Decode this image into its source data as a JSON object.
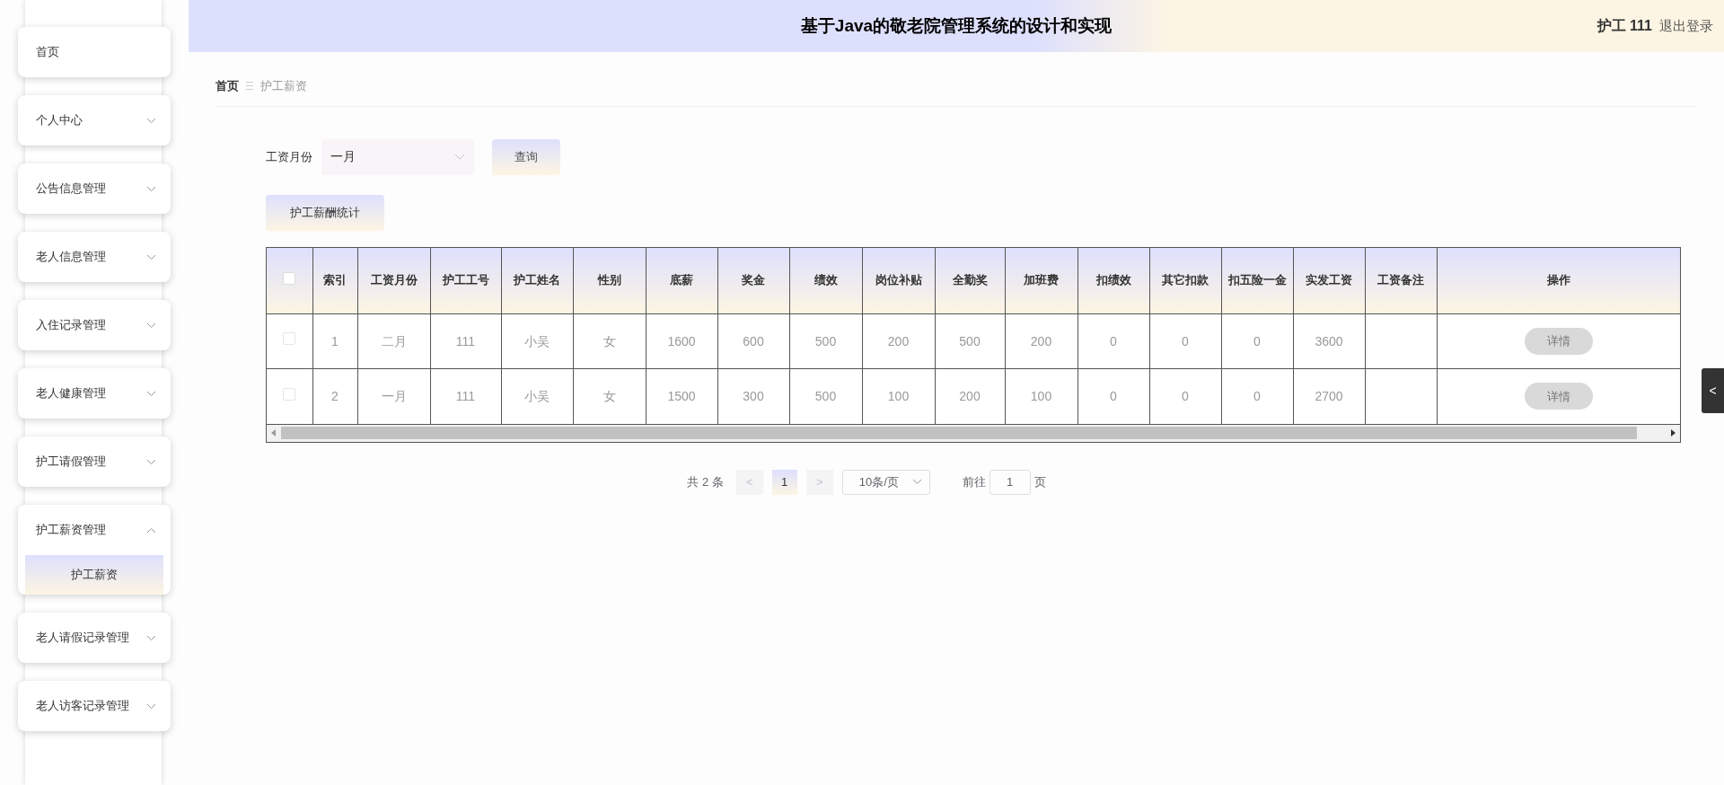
{
  "sidebar": {
    "items": [
      {
        "label": "首页",
        "kind": "link"
      },
      {
        "label": "个人中心",
        "kind": "menu",
        "expanded": false
      },
      {
        "label": "公告信息管理",
        "kind": "menu",
        "expanded": false
      },
      {
        "label": "老人信息管理",
        "kind": "menu",
        "expanded": false
      },
      {
        "label": "入住记录管理",
        "kind": "menu",
        "expanded": false
      },
      {
        "label": "老人健康管理",
        "kind": "menu",
        "expanded": false
      },
      {
        "label": "护工请假管理",
        "kind": "menu",
        "expanded": false
      },
      {
        "label": "护工薪资管理",
        "kind": "menu",
        "expanded": true,
        "children": [
          {
            "label": "护工薪资",
            "selected": true
          }
        ]
      },
      {
        "label": "老人请假记录管理",
        "kind": "menu",
        "expanded": false
      },
      {
        "label": "老人访客记录管理",
        "kind": "menu",
        "expanded": false
      }
    ]
  },
  "header": {
    "title": "基于Java的敬老院管理系统的设计和实现",
    "user": "护工 111",
    "logout": "退出登录"
  },
  "breadcrumb": [
    "首页",
    "护工薪资"
  ],
  "filter": {
    "label": "工资月份",
    "select_value": "一月",
    "search_button": "查询"
  },
  "stats_button": "护工薪酬统计",
  "table": {
    "select_all_checked": false,
    "columns": [
      "索引",
      "工资月份",
      "护工工号",
      "护工姓名",
      "性别",
      "底薪",
      "奖金",
      "绩效",
      "岗位补贴",
      "全勤奖",
      "加班费",
      "扣绩效",
      "其它扣款",
      "扣五险一金",
      "实发工资",
      "工资备注",
      "操作"
    ],
    "rows": [
      {
        "checked": false,
        "cells": [
          "1",
          "二月",
          "111",
          "小吴",
          "女",
          "1600",
          "600",
          "500",
          "200",
          "500",
          "200",
          "0",
          "0",
          "0",
          "3600",
          ""
        ],
        "action": "详情"
      },
      {
        "checked": false,
        "cells": [
          "2",
          "一月",
          "111",
          "小吴",
          "女",
          "1500",
          "300",
          "500",
          "100",
          "200",
          "100",
          "0",
          "0",
          "0",
          "2700",
          ""
        ],
        "action": "详情"
      }
    ]
  },
  "pagination": {
    "total": "共 2 条",
    "prev": "<",
    "pages": [
      {
        "label": "1",
        "selected": true
      }
    ],
    "next": ">",
    "page_size": "10条/页",
    "goto_label": "前往",
    "goto_value": "1",
    "goto_suffix": "页"
  },
  "side_tab": "<"
}
